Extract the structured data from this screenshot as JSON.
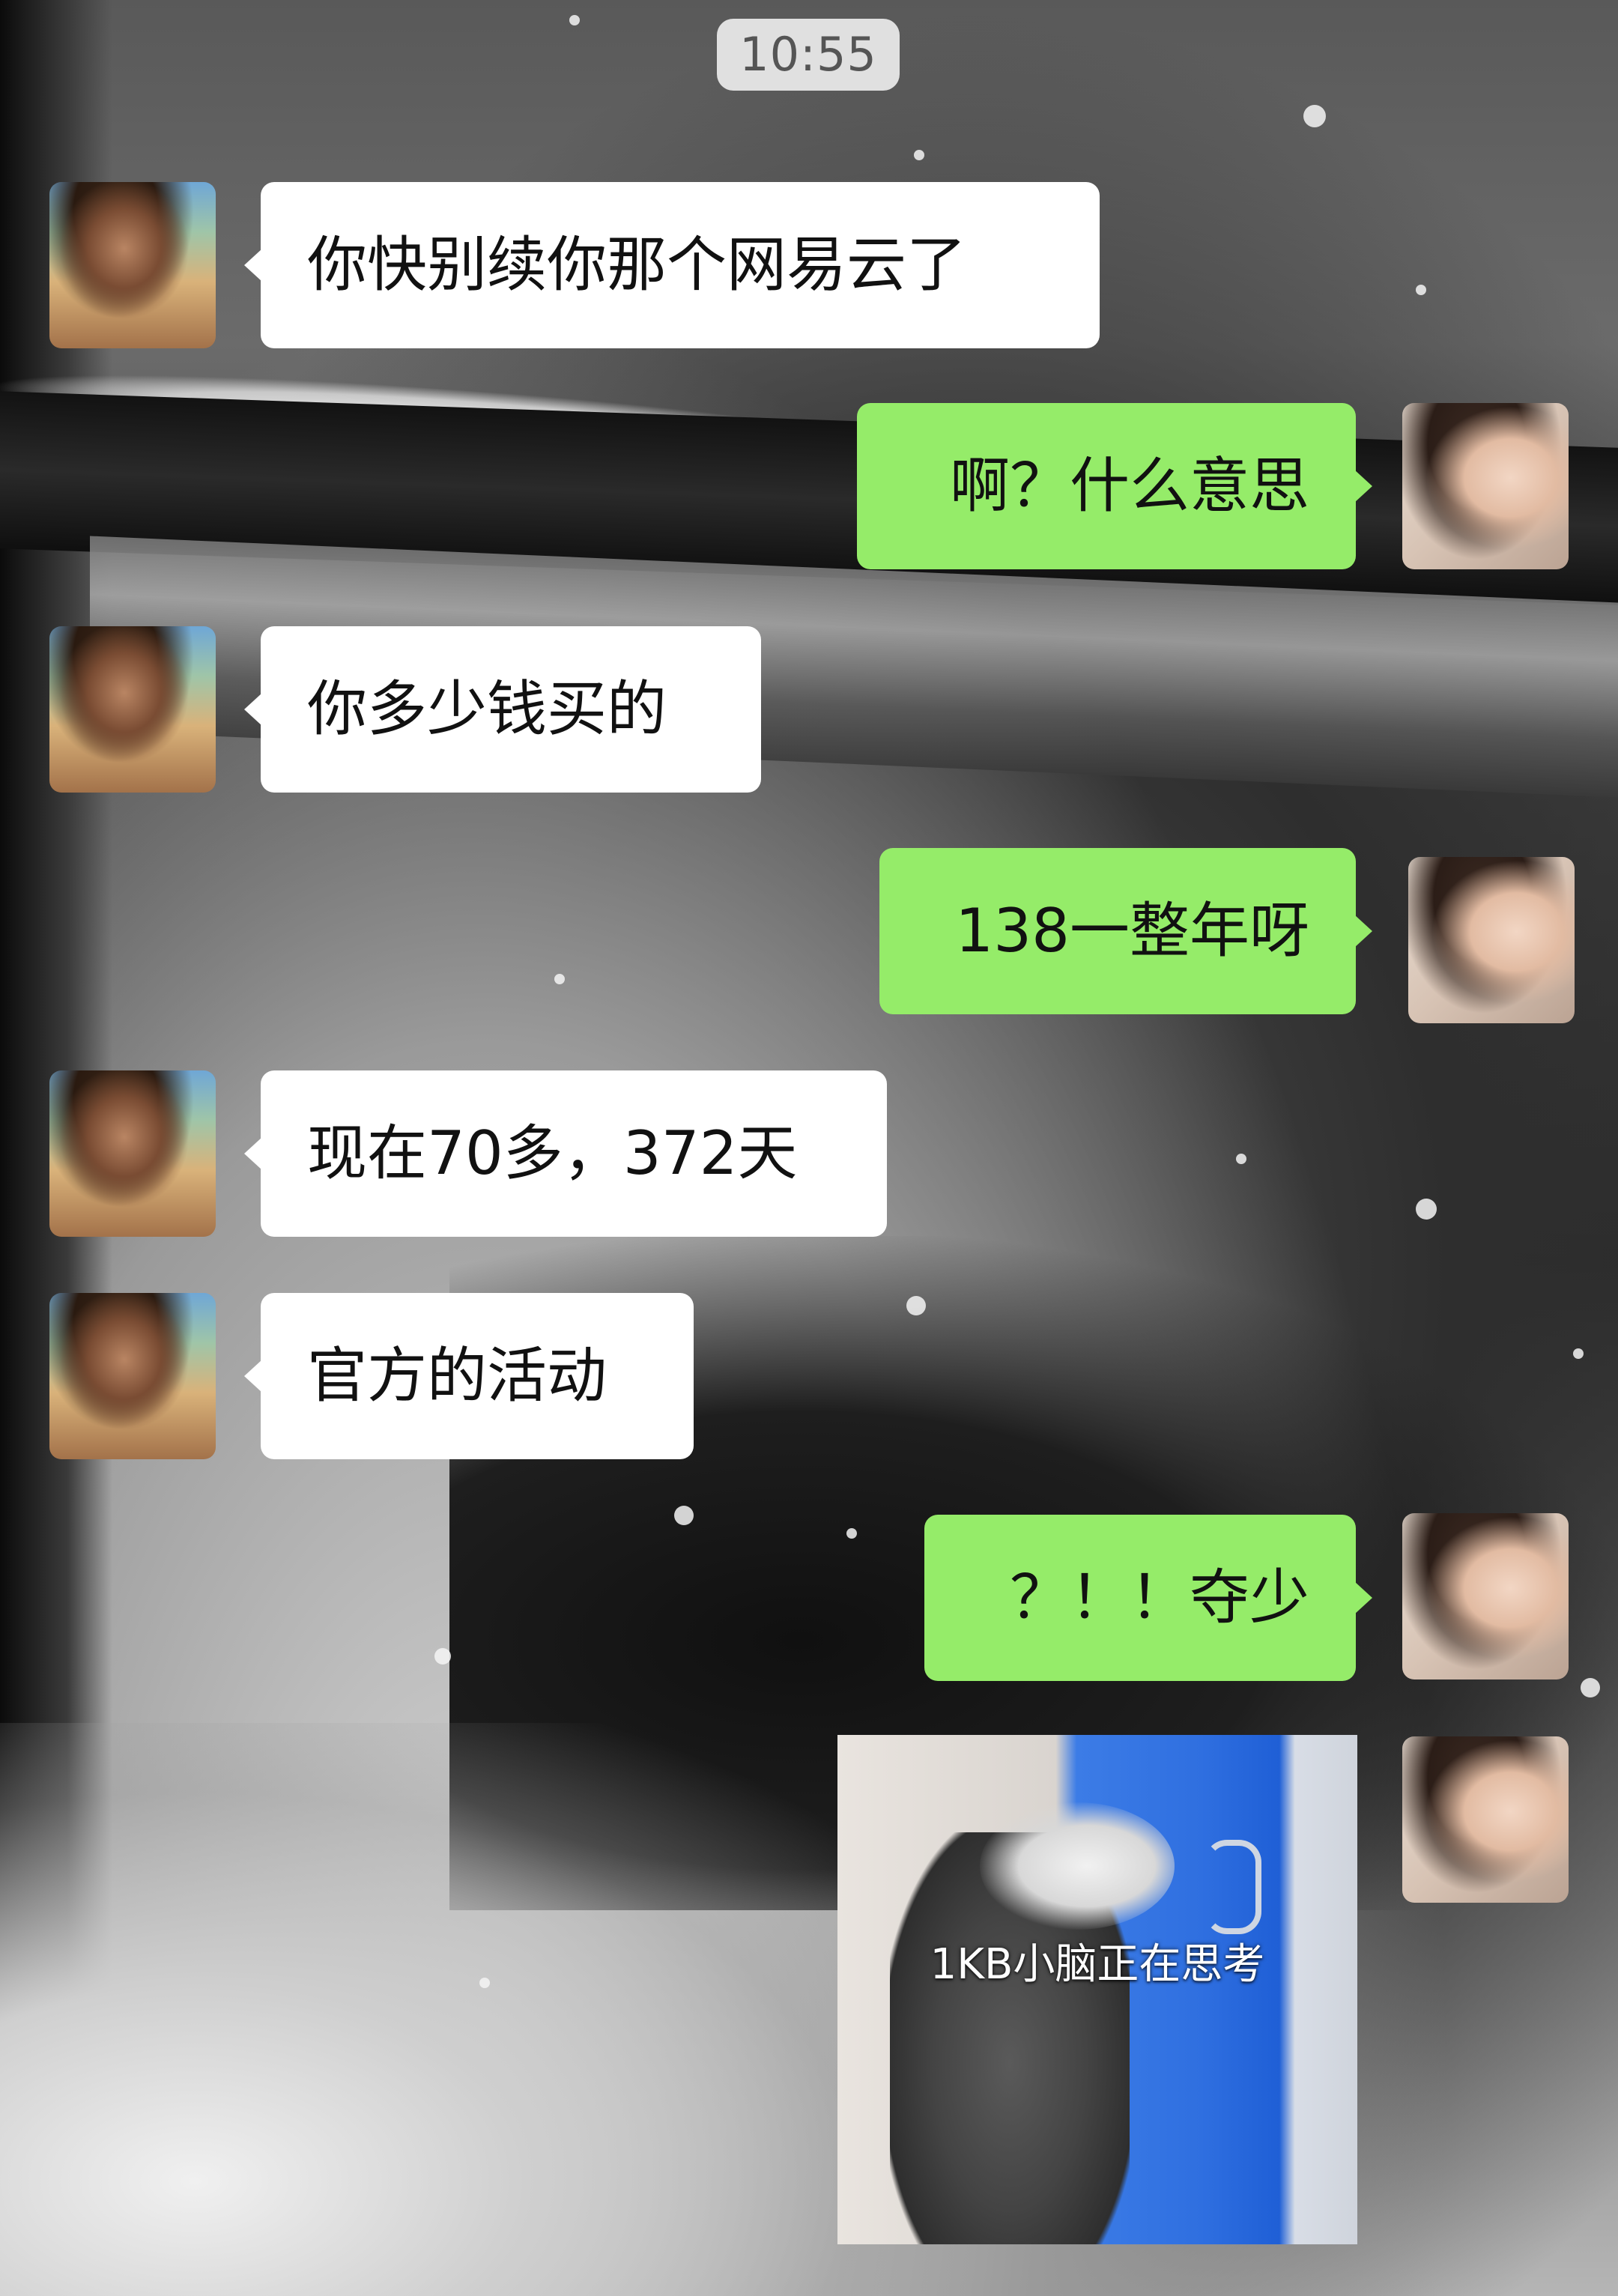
{
  "status": {
    "time": "10:55"
  },
  "contacts": {
    "other": {
      "avatar_icon": "boy-profile-avatar"
    },
    "self": {
      "avatar_icon": "girl-profile-avatar"
    }
  },
  "colors": {
    "incoming_bubble": "#ffffff",
    "outgoing_bubble": "#95ec69",
    "text": "#111111"
  },
  "messages": [
    {
      "sender": "other",
      "text": "你快别续你那个网易云了"
    },
    {
      "sender": "self",
      "text": "啊？什么意思"
    },
    {
      "sender": "other",
      "text": "你多少钱买的"
    },
    {
      "sender": "self",
      "text": "138一整年呀"
    },
    {
      "sender": "other",
      "text": "现在70多，372天"
    },
    {
      "sender": "other",
      "text": "官方的活动"
    },
    {
      "sender": "self",
      "text": "？！！夺少"
    },
    {
      "sender": "self",
      "type": "sticker",
      "caption": "1KB小脑正在思考"
    }
  ]
}
